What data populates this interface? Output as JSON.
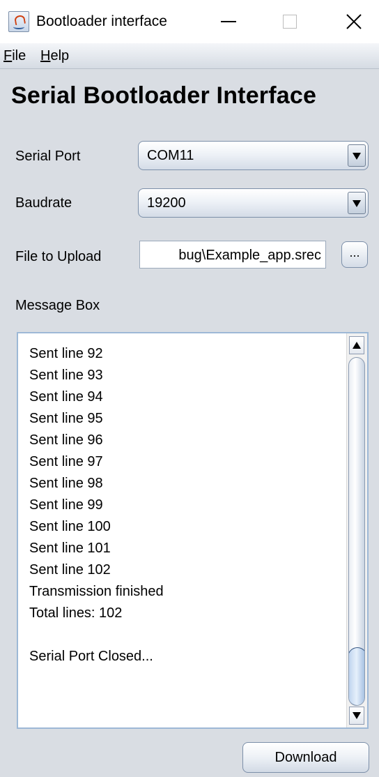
{
  "window": {
    "title": "Bootloader interface",
    "icon": "java-icon"
  },
  "menu": {
    "file": "File",
    "help": "Help"
  },
  "heading": "Serial Bootloader Interface",
  "serial_port": {
    "label": "Serial Port",
    "value": "COM11"
  },
  "baudrate": {
    "label": "Baudrate",
    "value": "19200"
  },
  "file_upload": {
    "label": "File to Upload",
    "value": "bug\\Example_app.srec",
    "browse_label": "..."
  },
  "message_box": {
    "label": "Message Box",
    "lines": [
      "Sent line 92",
      "Sent line 93",
      "Sent line 94",
      "Sent line 95",
      "Sent line 96",
      "Sent line 97",
      "Sent line 98",
      "Sent line 99",
      "Sent line 100",
      "Sent line 101",
      "Sent line 102",
      "Transmission finished",
      "Total lines: 102",
      "",
      "Serial Port Closed..."
    ]
  },
  "download_label": "Download"
}
